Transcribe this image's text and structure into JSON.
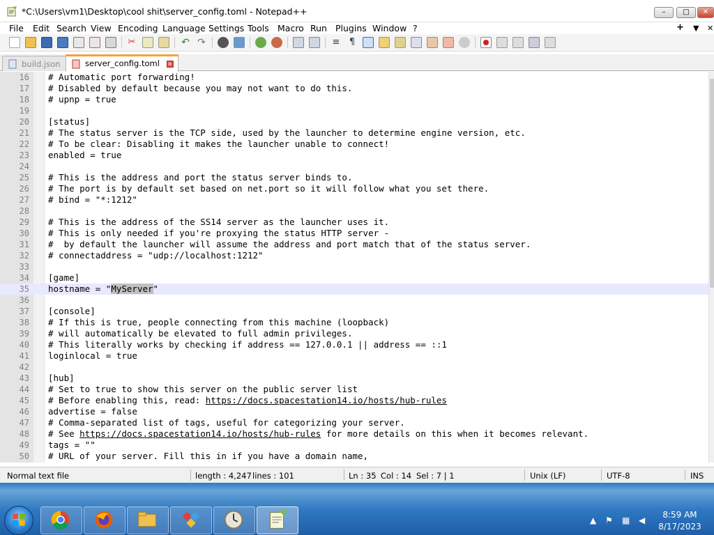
{
  "window": {
    "title": "*C:\\Users\\vm1\\Desktop\\cool shit\\server_config.toml - Notepad++",
    "controls": {
      "minimize": "–",
      "maximize": "□",
      "close": "✕"
    }
  },
  "menu": {
    "items": [
      "File",
      "Edit",
      "Search",
      "View",
      "Encoding",
      "Language",
      "Settings",
      "Tools",
      "Macro",
      "Run",
      "Plugins",
      "Window",
      "?"
    ],
    "right_plus": "+",
    "right_arrow": "▼",
    "right_close": "✕"
  },
  "tabs": [
    {
      "label": "build.json",
      "active": false,
      "close": "✕"
    },
    {
      "label": "server_config.toml",
      "active": true,
      "close": "✕"
    }
  ],
  "editor": {
    "current_line": 35,
    "lines": [
      {
        "n": "16",
        "text": "# Automatic port forwarding!"
      },
      {
        "n": "17",
        "text": "# Disabled by default because you may not want to do this."
      },
      {
        "n": "18",
        "text": "# upnp = true"
      },
      {
        "n": "19",
        "text": ""
      },
      {
        "n": "20",
        "text": "[status]"
      },
      {
        "n": "21",
        "text": "# The status server is the TCP side, used by the launcher to determine engine version, etc."
      },
      {
        "n": "22",
        "text": "# To be clear: Disabling it makes the launcher unable to connect!"
      },
      {
        "n": "23",
        "text": "enabled = true"
      },
      {
        "n": "24",
        "text": ""
      },
      {
        "n": "25",
        "text": "# This is the address and port the status server binds to."
      },
      {
        "n": "26",
        "text": "# The port is by default set based on net.port so it will follow what you set there."
      },
      {
        "n": "27",
        "text": "# bind = \"*:1212\""
      },
      {
        "n": "28",
        "text": ""
      },
      {
        "n": "29",
        "text": "# This is the address of the SS14 server as the launcher uses it."
      },
      {
        "n": "30",
        "text": "# This is only needed if you're proxying the status HTTP server -"
      },
      {
        "n": "31",
        "text": "#  by default the launcher will assume the address and port match that of the status server."
      },
      {
        "n": "32",
        "text": "# connectaddress = \"udp://localhost:1212\""
      },
      {
        "n": "33",
        "text": ""
      },
      {
        "n": "34",
        "text": "[game]"
      },
      {
        "n": "35",
        "text": "hostname = \"MyServer\""
      },
      {
        "n": "36",
        "text": ""
      },
      {
        "n": "37",
        "text": "[console]"
      },
      {
        "n": "38",
        "text": "# If this is true, people connecting from this machine (loopback)"
      },
      {
        "n": "39",
        "text": "# will automatically be elevated to full admin privileges."
      },
      {
        "n": "40",
        "text": "# This literally works by checking if address == 127.0.0.1 || address == ::1"
      },
      {
        "n": "41",
        "text": "loginlocal = true"
      },
      {
        "n": "42",
        "text": ""
      },
      {
        "n": "43",
        "text": "[hub]"
      },
      {
        "n": "44",
        "text": "# Set to true to show this server on the public server list"
      },
      {
        "n": "45",
        "text": "# Before enabling this, read: https://docs.spacestation14.io/hosts/hub-rules"
      },
      {
        "n": "46",
        "text": "advertise = false"
      },
      {
        "n": "47",
        "text": "# Comma-separated list of tags, useful for categorizing your server."
      },
      {
        "n": "48",
        "text": "# See https://docs.spacestation14.io/hosts/hub-rules for more details on this when it becomes relevant."
      },
      {
        "n": "49",
        "text": "tags = \"\""
      },
      {
        "n": "50",
        "text": "# URL of your server. Fill this in if you have a domain name,"
      }
    ],
    "selection_text": "MyServer",
    "link_url": "https://docs.spacestation14.io/hosts/hub-rules"
  },
  "status": {
    "file_type": "Normal text file",
    "length": "length : 4,247",
    "lines": "lines : 101",
    "ln": "Ln : 35",
    "col": "Col : 14",
    "sel": "Sel : 7 | 1",
    "eol": "Unix (LF)",
    "encoding": "UTF-8",
    "mode": "INS"
  },
  "taskbar": {
    "time": "8:59 AM",
    "date": "8/17/2023",
    "apps": [
      "chrome",
      "firefox",
      "file-explorer",
      "git-extensions",
      "clock-app",
      "notepad-plus-plus"
    ]
  },
  "colors": {
    "tab_accent": "#f4a23b",
    "current_line": "#e8e8ff",
    "selection": "#c0c0c0",
    "taskbar": "#2f78c2"
  }
}
